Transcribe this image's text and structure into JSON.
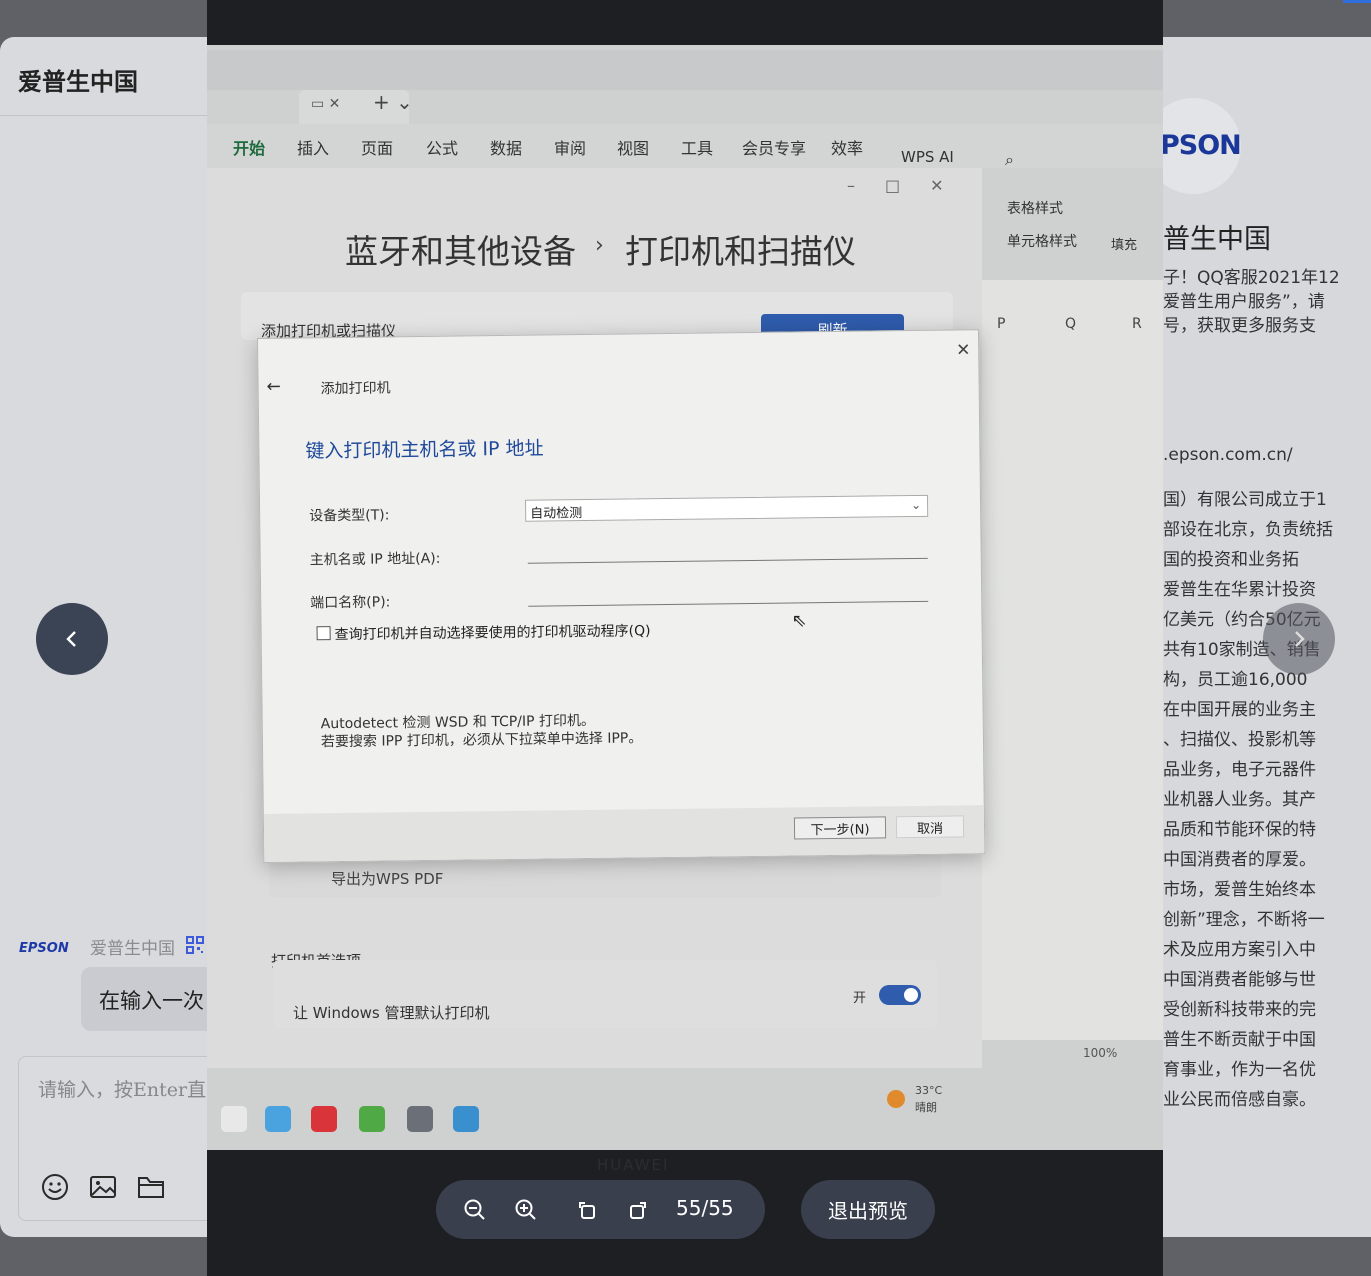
{
  "chat": {
    "title": "爱普生中国",
    "sender_logo": "EPSON",
    "sender_name": "爱普生中国",
    "message": "在输入一次",
    "input_placeholder": "请输入，按Enter直",
    "toolbar_icons": [
      "emoji-icon",
      "image-icon",
      "folder-icon"
    ]
  },
  "profile": {
    "logo_text": "PSON",
    "name": "普生中国",
    "desc": "子！QQ客服2021年12\n爱普生用户服务”，请\n号，获取更多服务支",
    "url": ".epson.com.cn/",
    "body": "国）有限公司成立于1\n部设在北京，负责统括\n国的投资和业务拓\n爱普生在华累计投资\n亿美元（约合50亿元\n共有10家制造、销售\n构，员工逾16,000\n在中国开展的业务主\n、扫描仪、投影机等\n品业务，电子元器件\n业机器人业务。其产\n品质和节能环保的特\n中国消费者的厚爱。\n市场，爱普生始终本\n创新”理念，不断将一\n术及应用方案引入中\n中国消费者能够与世\n受创新科技带来的完\n普生不断贡献于中国\n育事业，作为一名优\n业公民而倍感自豪。"
  },
  "photo": {
    "wps_ribbon": [
      "开始",
      "插入",
      "页面",
      "公式",
      "数据",
      "审阅",
      "视图",
      "工具",
      "会员专享",
      "效率",
      "WPS AI"
    ],
    "ribbon_right": [
      "表格样式",
      "单元格样式",
      "填充"
    ],
    "columns": [
      "P",
      "Q",
      "R"
    ],
    "settings_breadcrumb": "蓝牙和其他设备",
    "settings_page": "打印机和扫描仪",
    "add_printer_label": "添加打印机或扫描仪",
    "refresh_label": "刷新",
    "export_label": "导出为WPS PDF",
    "pref_title": "打印机首选项",
    "pref_label": "让 Windows 管理默认打印机",
    "toggle_label": "开",
    "zoom_label": "100%",
    "weather": "33°C",
    "weather_desc": "晴朗",
    "watermark": "HUAWEI",
    "dialog": {
      "crumb": "添加打印机",
      "heading": "键入打印机主机名或 IP 地址",
      "device_type_label": "设备类型(T):",
      "device_type_value": "自动检测",
      "host_label": "主机名或 IP 地址(A):",
      "port_label": "端口名称(P):",
      "checkbox_label": "查询打印机并自动选择要使用的打印机驱动程序(Q)",
      "info_line1": "Autodetect 检测 WSD 和 TCP/IP 打印机。",
      "info_line2": "若要搜索 IPP 打印机，必须从下拉菜单中选择 IPP。",
      "next_label": "下一步(N)",
      "cancel_label": "取消"
    }
  },
  "viewer": {
    "counter": "55/55",
    "exit_label": "退出预览"
  }
}
